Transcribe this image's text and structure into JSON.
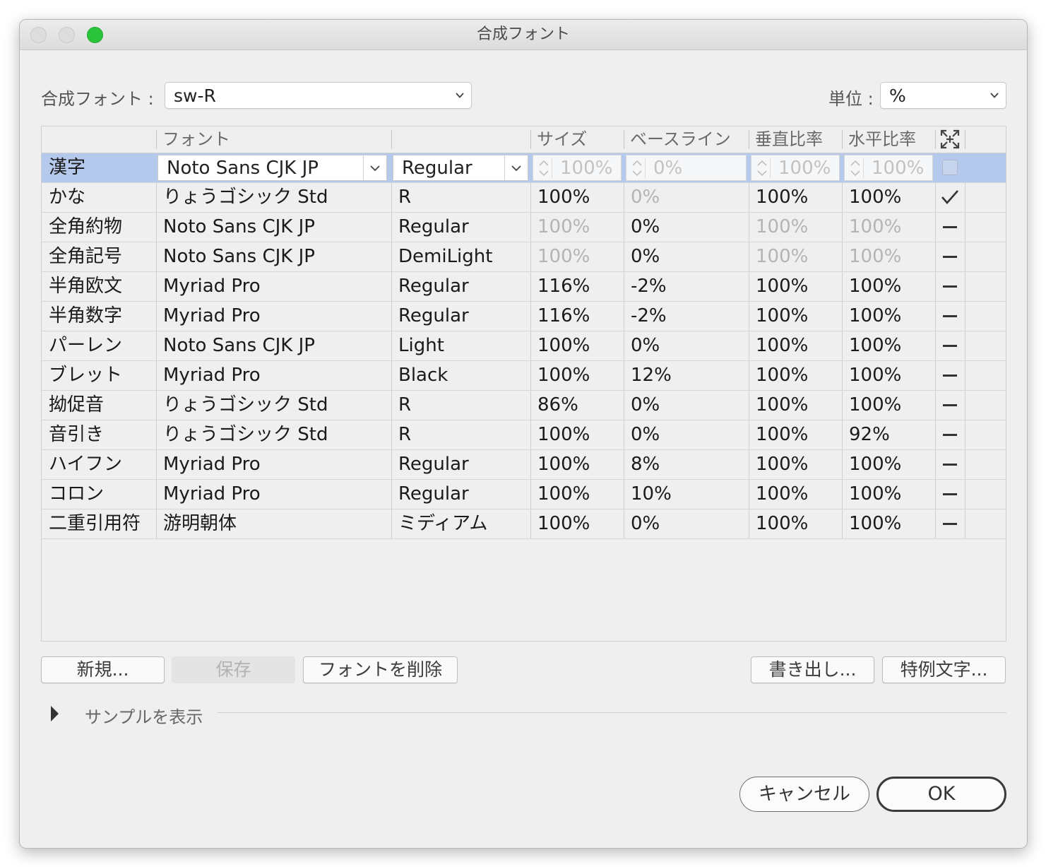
{
  "window": {
    "title": "合成フォント"
  },
  "top": {
    "font_label": "合成フォント :",
    "font_value": "sw-R",
    "unit_label": "単位 :",
    "unit_value": "%"
  },
  "table": {
    "headers": {
      "font": "フォント",
      "style": "",
      "size": "サイズ",
      "baseline": "ベースライン",
      "vscale": "垂直比率",
      "hscale": "水平比率",
      "scale_icon": "scale-center-icon"
    },
    "selected_row": {
      "name": "漢字",
      "font": "Noto Sans CJK JP",
      "style": "Regular",
      "size": "100%",
      "baseline": "0%",
      "vscale": "100%",
      "hscale": "100%"
    },
    "rows": [
      {
        "name": "かな",
        "font": "りょうゴシック Std",
        "style": "R",
        "size": "100%",
        "baseline": "0%",
        "vscale": "100%",
        "hscale": "100%",
        "mark": "checkmark"
      },
      {
        "name": "全角約物",
        "font": "Noto Sans CJK JP",
        "style": "Regular",
        "size": "100%",
        "baseline": "0%",
        "vscale": "100%",
        "hscale": "100%",
        "mark": "dash"
      },
      {
        "name": "全角記号",
        "font": "Noto Sans CJK JP",
        "style": "DemiLight",
        "size": "100%",
        "baseline": "0%",
        "vscale": "100%",
        "hscale": "100%",
        "mark": "dash"
      },
      {
        "name": "半角欧文",
        "font": "Myriad Pro",
        "style": "Regular",
        "size": "116%",
        "baseline": "-2%",
        "vscale": "100%",
        "hscale": "100%",
        "mark": "dash"
      },
      {
        "name": "半角数字",
        "font": "Myriad Pro",
        "style": "Regular",
        "size": "116%",
        "baseline": "-2%",
        "vscale": "100%",
        "hscale": "100%",
        "mark": "dash"
      },
      {
        "name": "パーレン",
        "font": "Noto Sans CJK JP",
        "style": "Light",
        "size": "100%",
        "baseline": "0%",
        "vscale": "100%",
        "hscale": "100%",
        "mark": "dash"
      },
      {
        "name": "ブレット",
        "font": "Myriad Pro",
        "style": "Black",
        "size": "100%",
        "baseline": "12%",
        "vscale": "100%",
        "hscale": "100%",
        "mark": "dash"
      },
      {
        "name": "拗促音",
        "font": "りょうゴシック Std",
        "style": "R",
        "size": "86%",
        "baseline": "0%",
        "vscale": "100%",
        "hscale": "100%",
        "mark": "dash"
      },
      {
        "name": "音引き",
        "font": "りょうゴシック Std",
        "style": "R",
        "size": "100%",
        "baseline": "0%",
        "vscale": "100%",
        "hscale": "92%",
        "mark": "dash"
      },
      {
        "name": "ハイフン",
        "font": "Myriad Pro",
        "style": "Regular",
        "size": "100%",
        "baseline": "8%",
        "vscale": "100%",
        "hscale": "100%",
        "mark": "dash"
      },
      {
        "name": "コロン",
        "font": "Myriad Pro",
        "style": "Regular",
        "size": "100%",
        "baseline": "10%",
        "vscale": "100%",
        "hscale": "100%",
        "mark": "dash"
      },
      {
        "name": "二重引用符",
        "font": "游明朝体",
        "style": "ミディアム",
        "size": "100%",
        "baseline": "0%",
        "vscale": "100%",
        "hscale": "100%",
        "mark": "dash"
      }
    ]
  },
  "buttons": {
    "new": "新規...",
    "save": "保存",
    "delete_font": "フォントを削除",
    "export": "書き出し...",
    "special": "特例文字..."
  },
  "sample": {
    "label": "サンプルを表示"
  },
  "footer": {
    "cancel": "キャンセル",
    "ok": "OK"
  },
  "colors": {
    "selection": "#b5c9ec",
    "zoom": "#2ac43a"
  }
}
